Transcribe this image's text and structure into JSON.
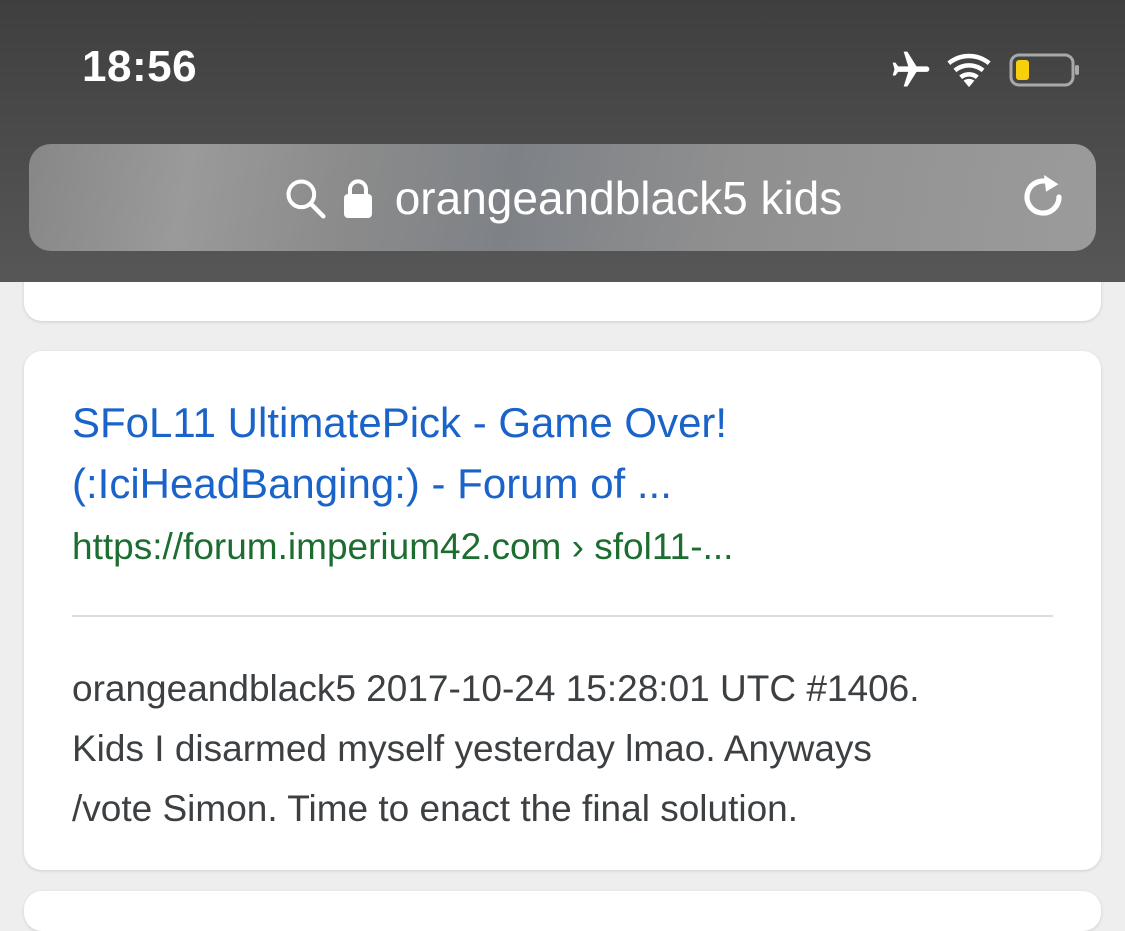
{
  "status_bar": {
    "time": "18:56",
    "icons": [
      "airplane-icon",
      "wifi-icon",
      "battery-icon"
    ],
    "battery_color": "#f7cf0b"
  },
  "browser": {
    "search_query": "orangeandblack5 kids",
    "icons": [
      "search-icon",
      "lock-icon",
      "reload-icon"
    ]
  },
  "result": {
    "title_line1": "SFoL11 UltimatePick - Game Over!",
    "title_line2": "(:IciHeadBanging:) - Forum of ...",
    "url": "https://forum.imperium42.com › sfol11-...",
    "snippet_line1": "orangeandblack5 2017-10-24 15:28:01 UTC #1406.",
    "snippet_line2": "Kids I disarmed myself yesterday lmao. Anyways",
    "snippet_line3": "/vote Simon. Time to enact the final solution."
  },
  "colors": {
    "link": "#1a63c9",
    "url": "#1b6e2f",
    "snippet": "#3c4043"
  }
}
